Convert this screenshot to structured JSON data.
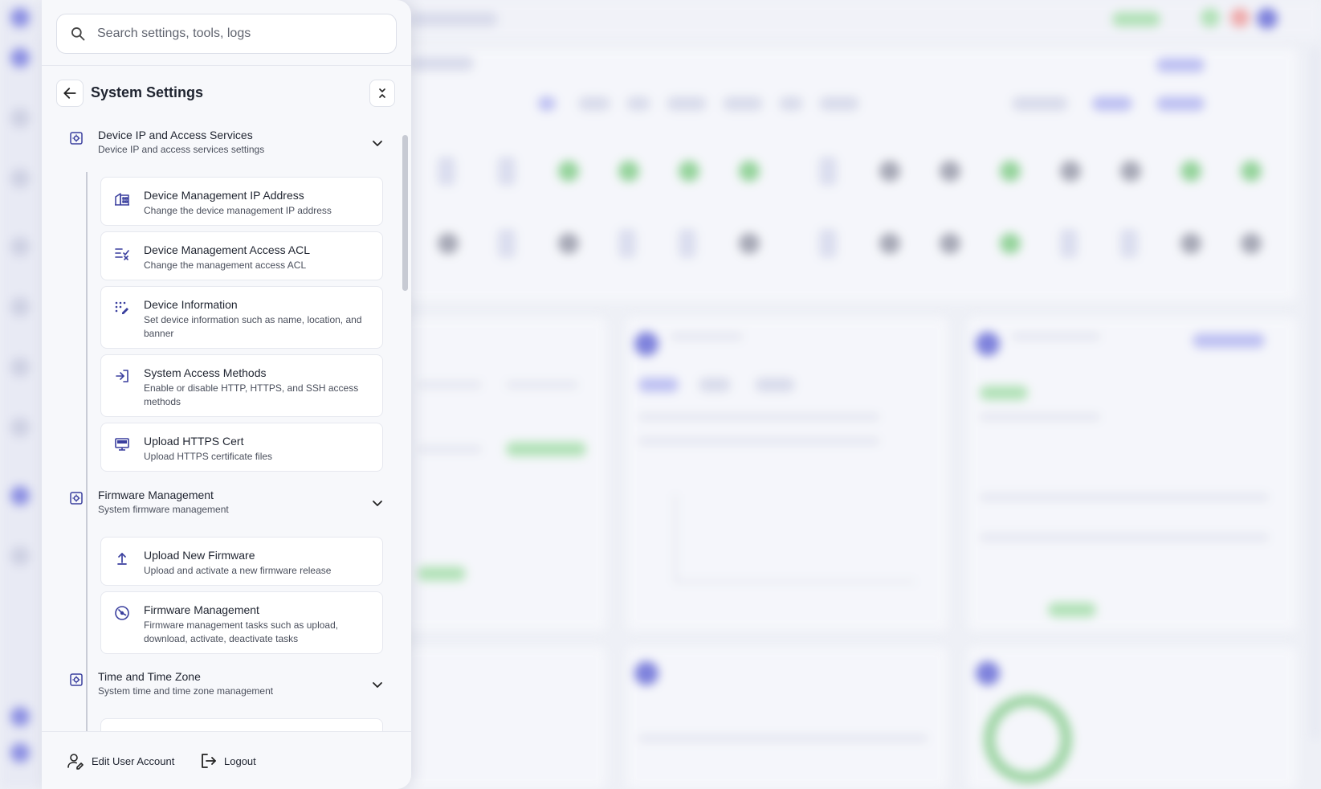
{
  "search": {
    "placeholder": "Search settings, tools, logs"
  },
  "panel": {
    "title": "System Settings"
  },
  "sections": [
    {
      "title": "Device IP and Access Services",
      "subtitle": "Device IP and access services settings",
      "items": [
        {
          "title": "Device Management IP Address",
          "subtitle": "Change the device management IP address",
          "icon": "building-icon"
        },
        {
          "title": "Device Management Access ACL",
          "subtitle": "Change the management access ACL",
          "icon": "list-check-icon"
        },
        {
          "title": "Device Information",
          "subtitle": "Set device information such as name, location, and banner",
          "icon": "dots-edit-icon"
        },
        {
          "title": "System Access Methods",
          "subtitle": "Enable or disable HTTP, HTTPS, and SSH access methods",
          "icon": "login-icon"
        },
        {
          "title": "Upload HTTPS Cert",
          "subtitle": "Upload HTTPS certificate files",
          "icon": "monitor-icon"
        }
      ]
    },
    {
      "title": "Firmware Management",
      "subtitle": "System firmware management",
      "items": [
        {
          "title": "Upload New Firmware",
          "subtitle": "Upload and activate a new firmware release",
          "icon": "upload-icon"
        },
        {
          "title": "Firmware Management",
          "subtitle": "Firmware management tasks such as upload, download, activate, deactivate tasks",
          "icon": "gauge-icon"
        }
      ]
    },
    {
      "title": "Time and Time Zone",
      "subtitle": "System time and time zone management",
      "items": []
    }
  ],
  "footer": {
    "edit_account": "Edit User Account",
    "logout": "Logout"
  },
  "colors": {
    "accent": "#5b5fd6",
    "panel_bg": "#f7f8fb",
    "icon": "#3a3f9e"
  }
}
